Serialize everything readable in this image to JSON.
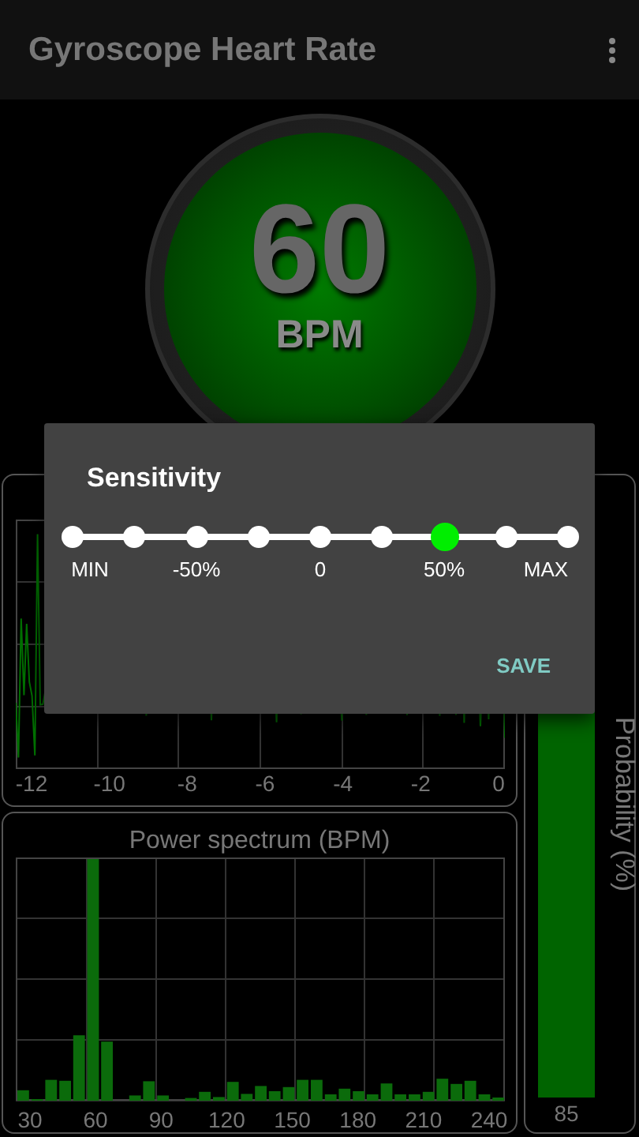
{
  "app_bar": {
    "title": "Gyroscope Heart Rate"
  },
  "gauge": {
    "value": "60",
    "unit": "BPM"
  },
  "waveform": {
    "x_labels": [
      "-12",
      "-10",
      "-8",
      "-6",
      "-4",
      "-2",
      "0"
    ]
  },
  "spectrum": {
    "title": "Power spectrum (BPM)",
    "x_labels": [
      "30",
      "60",
      "90",
      "120",
      "150",
      "180",
      "210",
      "240"
    ]
  },
  "probability": {
    "title": "Probability (%)",
    "level": 0.85,
    "reading": "85"
  },
  "dialog": {
    "title": "Sensitivity",
    "slider": {
      "level": 0.75,
      "labels": [
        "MIN",
        "-50%",
        "0",
        "50%",
        "MAX"
      ]
    },
    "buttons": [
      "SAVE"
    ]
  }
}
